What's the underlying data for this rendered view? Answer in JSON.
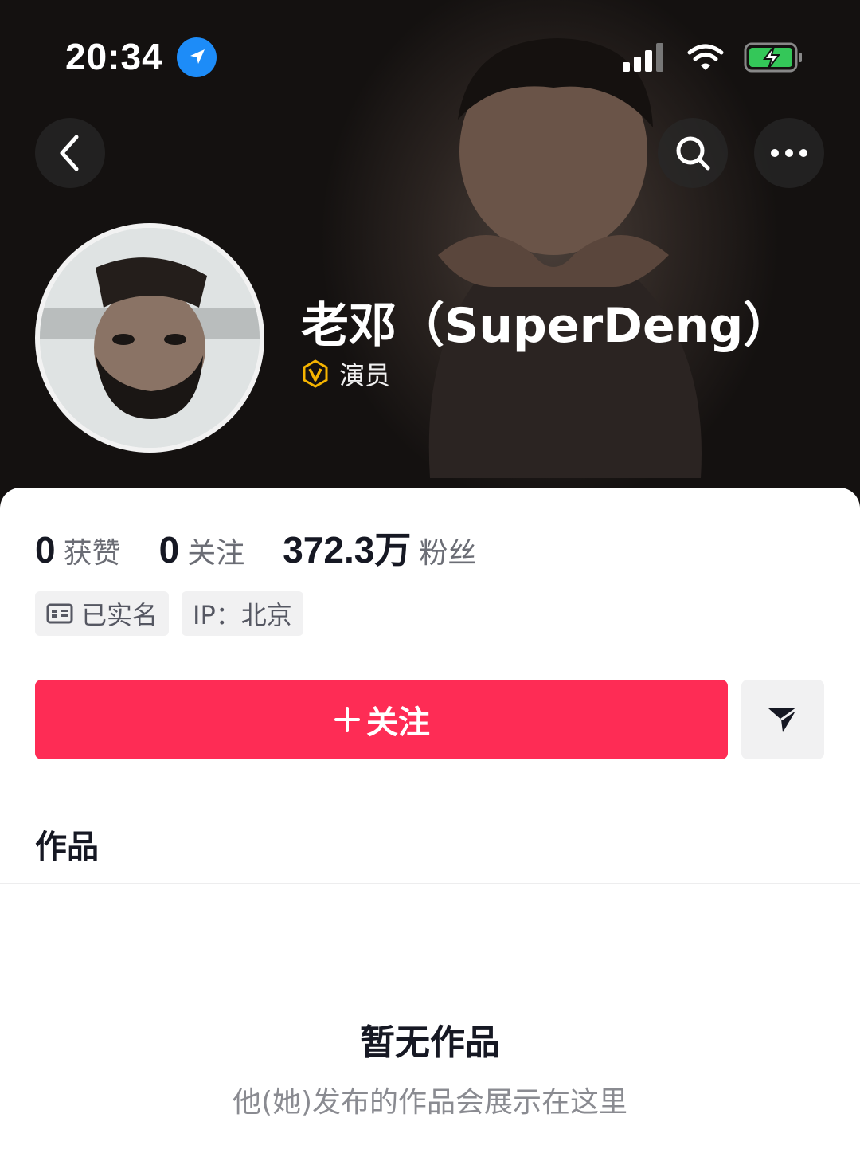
{
  "status_bar": {
    "time": "20:34",
    "icons": [
      "location-arrow-icon",
      "cellular-signal-icon",
      "wifi-icon",
      "battery-charging-icon"
    ],
    "battery_color": "#34c759"
  },
  "header": {
    "back_icon": "back-chevron-icon",
    "search_icon": "search-icon",
    "more_icon": "more-dots-icon"
  },
  "profile": {
    "name": "老邓（SuperDeng）",
    "verified_badge": "V",
    "verified_color": "#f5b400",
    "role": "演员"
  },
  "stats": [
    {
      "value": "0",
      "label": "获赞"
    },
    {
      "value": "0",
      "label": "关注"
    },
    {
      "value": "372.3万",
      "label": "粉丝"
    }
  ],
  "tags": {
    "real_name": "已实名",
    "ip": "IP：北京"
  },
  "actions": {
    "follow_label": "关注",
    "follow_color": "#fe2c55",
    "share_icon": "send-icon"
  },
  "tabs": {
    "works": "作品"
  },
  "empty_state": {
    "title": "暂无作品",
    "description": "他(她)发布的作品会展示在这里"
  }
}
